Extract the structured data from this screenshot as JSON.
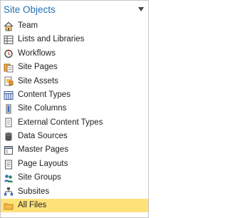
{
  "panel": {
    "title": "Site Objects",
    "items": [
      {
        "label": "Team",
        "icon": "home-icon"
      },
      {
        "label": "Lists and Libraries",
        "icon": "list-library-icon"
      },
      {
        "label": "Workflows",
        "icon": "workflow-icon"
      },
      {
        "label": "Site Pages",
        "icon": "site-pages-icon"
      },
      {
        "label": "Site Assets",
        "icon": "site-assets-icon"
      },
      {
        "label": "Content Types",
        "icon": "content-types-icon"
      },
      {
        "label": "Site Columns",
        "icon": "site-columns-icon"
      },
      {
        "label": "External Content Types",
        "icon": "external-content-types-icon"
      },
      {
        "label": "Data Sources",
        "icon": "data-sources-icon"
      },
      {
        "label": "Master Pages",
        "icon": "master-pages-icon"
      },
      {
        "label": "Page Layouts",
        "icon": "page-layouts-icon"
      },
      {
        "label": "Site Groups",
        "icon": "site-groups-icon"
      },
      {
        "label": "Subsites",
        "icon": "subsites-icon"
      },
      {
        "label": "All Files",
        "icon": "all-files-icon",
        "selected": true
      }
    ]
  },
  "colors": {
    "title": "#1f6fb5",
    "selected_background": "#fde27a",
    "border": "#c6c6c6"
  }
}
